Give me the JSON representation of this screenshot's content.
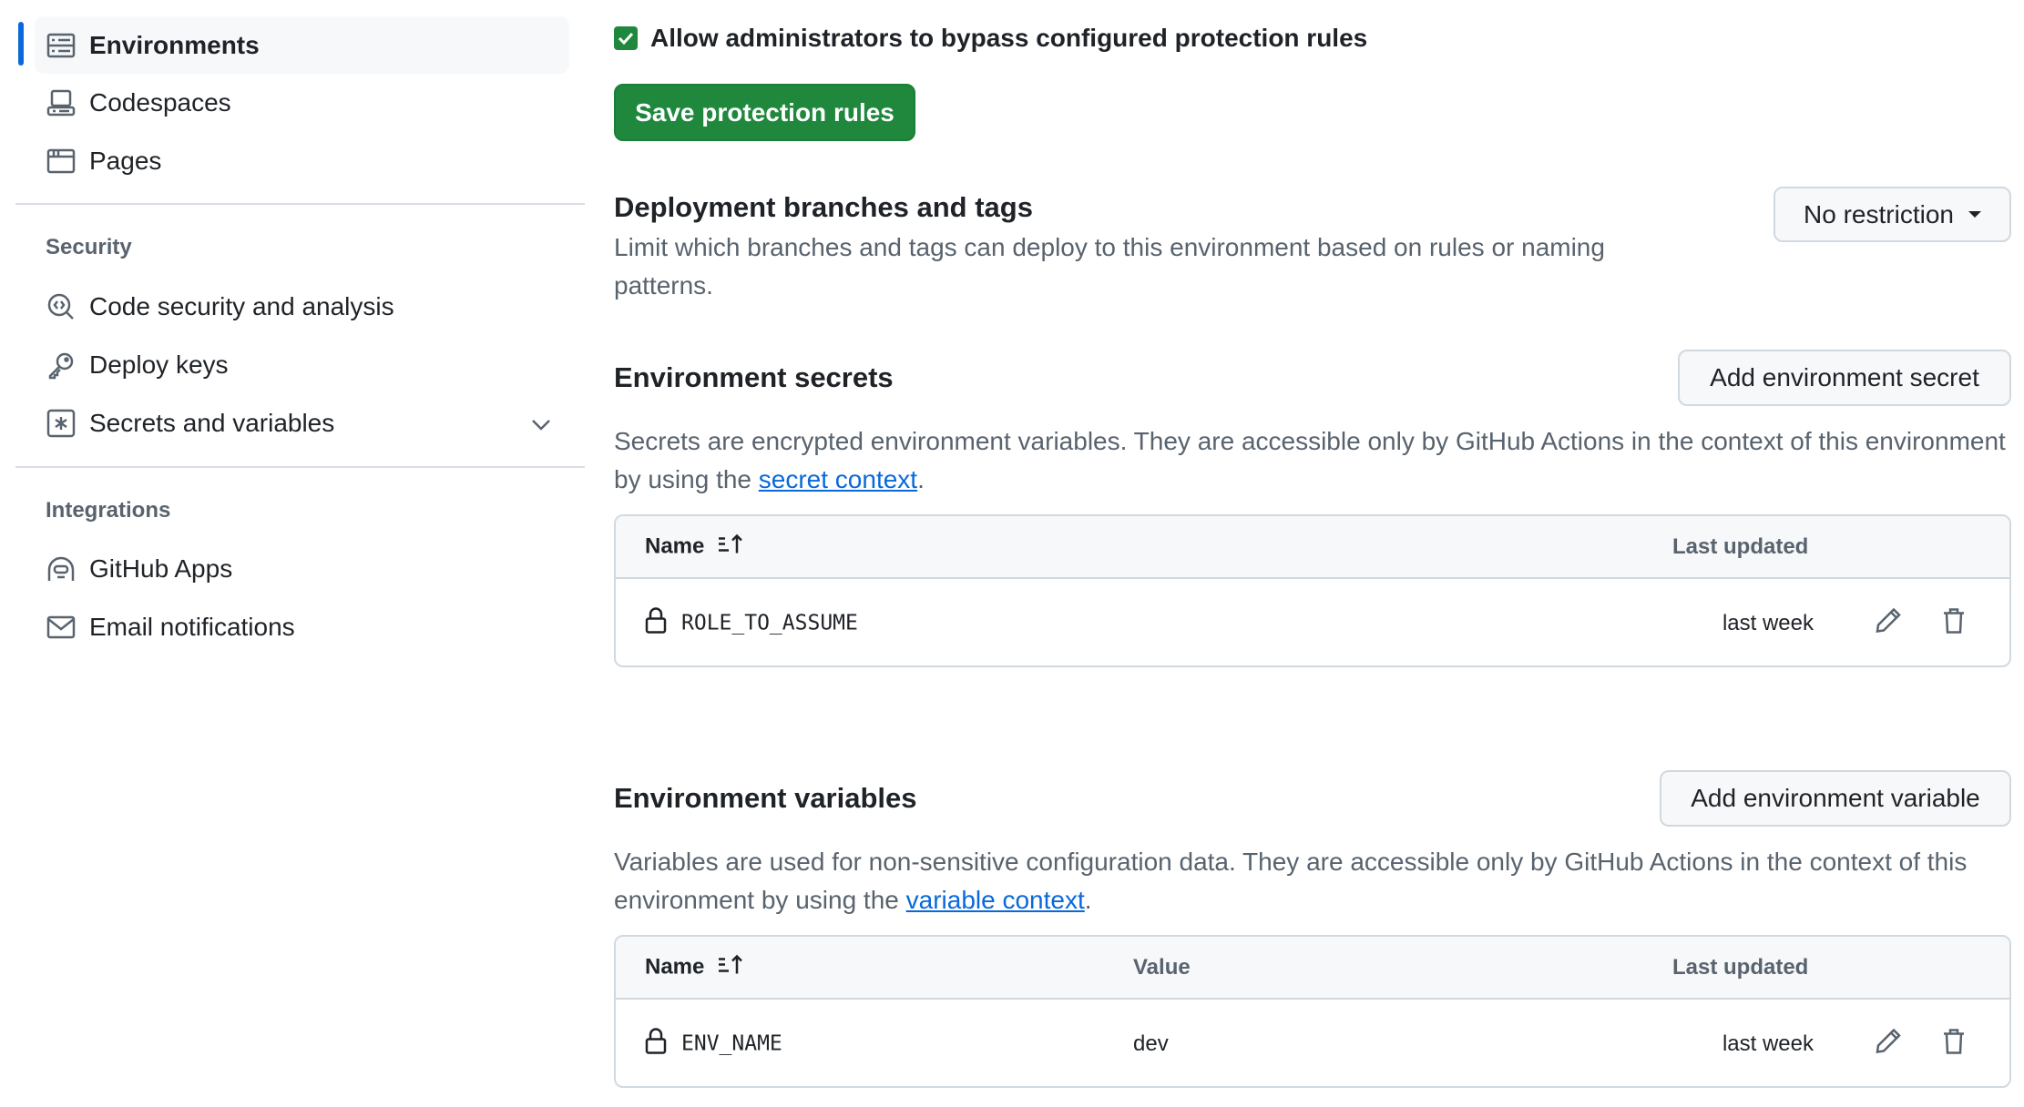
{
  "sidebar": {
    "items_top": [
      {
        "label": "Environments",
        "icon": "server-icon",
        "active": true
      },
      {
        "label": "Codespaces",
        "icon": "codespaces-icon"
      },
      {
        "label": "Pages",
        "icon": "browser-icon"
      }
    ],
    "security_header": "Security",
    "security_items": [
      {
        "label": "Code security and analysis",
        "icon": "codescan-icon"
      },
      {
        "label": "Deploy keys",
        "icon": "key-icon"
      },
      {
        "label": "Secrets and variables",
        "icon": "key-asterisk-icon"
      }
    ],
    "integrations_header": "Integrations",
    "integration_items": [
      {
        "label": "GitHub Apps",
        "icon": "apps-icon"
      },
      {
        "label": "Email notifications",
        "icon": "mail-icon"
      }
    ]
  },
  "main": {
    "admin_bypass_label": "Allow administrators to bypass configured protection rules",
    "admin_bypass_checked": true,
    "save_label": "Save protection rules",
    "deployment": {
      "title": "Deployment branches and tags",
      "description": "Limit which branches and tags can deploy to this environment based on rules or naming patterns.",
      "select_value": "No restriction"
    },
    "secrets": {
      "title": "Environment secrets",
      "add_label": "Add environment secret",
      "description": "Secrets are encrypted environment variables. They are accessible only by GitHub Actions in the context of this environment by using the ",
      "link": "secret context",
      "after": ".",
      "columns": {
        "name": "Name",
        "updated": "Last updated"
      },
      "rows": [
        {
          "name": "ROLE_TO_ASSUME",
          "updated": "last week"
        }
      ]
    },
    "variables": {
      "title": "Environment variables",
      "add_label": "Add environment variable",
      "description": "Variables are used for non-sensitive configuration data. They are accessible only by GitHub Actions in the context of this environment by using the ",
      "link": "variable context",
      "after": ".",
      "columns": {
        "name": "Name",
        "value": "Value",
        "updated": "Last updated"
      },
      "rows": [
        {
          "name": "ENV_NAME",
          "value": "dev",
          "updated": "last week"
        }
      ]
    }
  },
  "colors": {
    "accent": "#0969da",
    "primary_button": "#1f883d"
  }
}
